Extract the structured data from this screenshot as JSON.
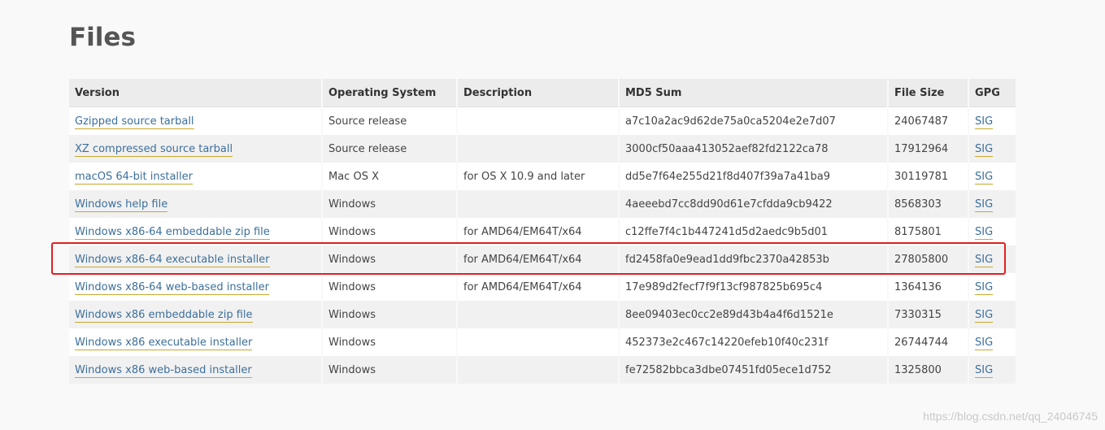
{
  "page": {
    "title": "Files"
  },
  "table": {
    "headers": [
      "Version",
      "Operating System",
      "Description",
      "MD5 Sum",
      "File Size",
      "GPG"
    ],
    "rows": [
      {
        "version": "Gzipped source tarball",
        "os": "Source release",
        "description": "",
        "md5": "a7c10a2ac9d62de75a0ca5204e2e7d07",
        "size": "24067487",
        "gpg": "SIG"
      },
      {
        "version": "XZ compressed source tarball",
        "os": "Source release",
        "description": "",
        "md5": "3000cf50aaa413052aef82fd2122ca78",
        "size": "17912964",
        "gpg": "SIG"
      },
      {
        "version": "macOS 64-bit installer",
        "os": "Mac OS X",
        "description": "for OS X 10.9 and later",
        "md5": "dd5e7f64e255d21f8d407f39a7a41ba9",
        "size": "30119781",
        "gpg": "SIG"
      },
      {
        "version": "Windows help file",
        "os": "Windows",
        "description": "",
        "md5": "4aeeebd7cc8dd90d61e7cfdda9cb9422",
        "size": "8568303",
        "gpg": "SIG"
      },
      {
        "version": "Windows x86-64 embeddable zip file",
        "os": "Windows",
        "description": "for AMD64/EM64T/x64",
        "md5": "c12ffe7f4c1b447241d5d2aedc9b5d01",
        "size": "8175801",
        "gpg": "SIG"
      },
      {
        "version": "Windows x86-64 executable installer",
        "os": "Windows",
        "description": "for AMD64/EM64T/x64",
        "md5": "fd2458fa0e9ead1dd9fbc2370a42853b",
        "size": "27805800",
        "gpg": "SIG"
      },
      {
        "version": "Windows x86-64 web-based installer",
        "os": "Windows",
        "description": "for AMD64/EM64T/x64",
        "md5": "17e989d2fecf7f9f13cf987825b695c4",
        "size": "1364136",
        "gpg": "SIG"
      },
      {
        "version": "Windows x86 embeddable zip file",
        "os": "Windows",
        "description": "",
        "md5": "8ee09403ec0cc2e89d43b4a4f6d1521e",
        "size": "7330315",
        "gpg": "SIG"
      },
      {
        "version": "Windows x86 executable installer",
        "os": "Windows",
        "description": "",
        "md5": "452373e2c467c14220efeb10f40c231f",
        "size": "26744744",
        "gpg": "SIG"
      },
      {
        "version": "Windows x86 web-based installer",
        "os": "Windows",
        "description": "",
        "md5": "fe72582bbca3dbe07451fd05ece1d752",
        "size": "1325800",
        "gpg": "SIG"
      }
    ]
  },
  "annotation": {
    "highlight_color": "#e02020"
  },
  "watermark": "https://blog.csdn.net/qq_24046745",
  "colors": {
    "link": "#3c6f9b",
    "link_underline": "#c7a82d"
  }
}
